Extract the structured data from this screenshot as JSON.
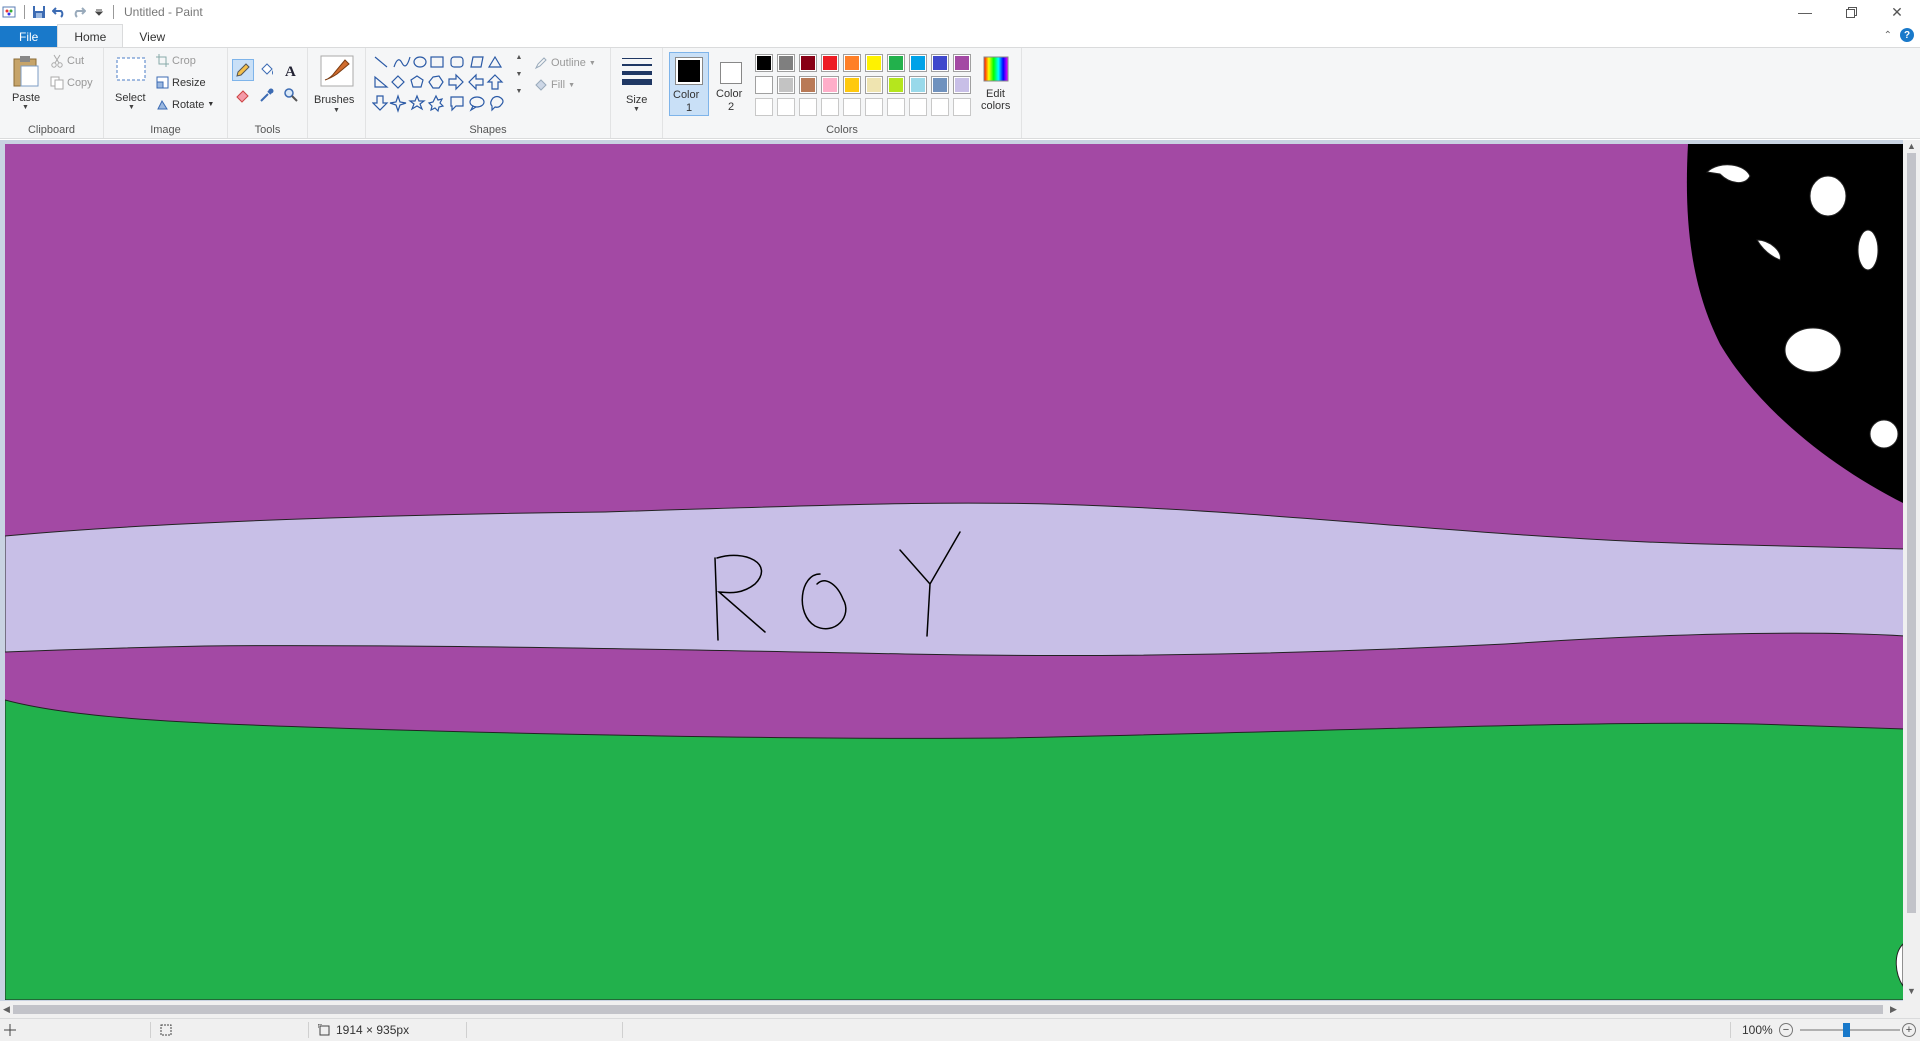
{
  "window": {
    "title": "Untitled - Paint"
  },
  "tabs": [
    {
      "label": "File"
    },
    {
      "label": "Home"
    },
    {
      "label": "View"
    }
  ],
  "ribbon": {
    "clipboard": {
      "label": "Clipboard",
      "paste": "Paste",
      "cut": "Cut",
      "copy": "Copy"
    },
    "image": {
      "label": "Image",
      "select": "Select",
      "crop": "Crop",
      "resize": "Resize",
      "rotate": "Rotate"
    },
    "tools": {
      "label": "Tools"
    },
    "brushes": {
      "label": "Brushes"
    },
    "shapes": {
      "label": "Shapes",
      "outline": "Outline",
      "fill": "Fill"
    },
    "size": {
      "label": "Size"
    },
    "colors": {
      "label": "Colors",
      "color1": "Color 1",
      "color1_line2": "1",
      "color1_line1": "Color",
      "color2_line1": "Color",
      "color2_line2": "2",
      "edit_colors_line1": "Edit",
      "edit_colors_line2": "colors",
      "color1_value": "#000000",
      "color2_value": "#ffffff",
      "palette_row1": [
        "#000000",
        "#7f7f7f",
        "#880015",
        "#ed1c24",
        "#ff7f27",
        "#fff200",
        "#22b14c",
        "#00a2e8",
        "#3f48cc",
        "#a349a4"
      ],
      "palette_row2": [
        "#ffffff",
        "#c3c3c3",
        "#b97a57",
        "#ffaec9",
        "#ffc90e",
        "#efe4b0",
        "#b5e61d",
        "#99d9ea",
        "#7092be",
        "#c8bfe7"
      ],
      "palette_row3": [
        "#ffffff",
        "#ffffff",
        "#ffffff",
        "#ffffff",
        "#ffffff",
        "#ffffff",
        "#ffffff",
        "#ffffff",
        "#ffffff",
        "#ffffff"
      ]
    }
  },
  "drawing": {
    "sky_color": "#a349a4",
    "band_color": "#c8bfe7",
    "grass_color": "#22b14c",
    "moon_color": "#000000",
    "text": "ROY"
  },
  "status": {
    "image_size": "1914 × 935px",
    "zoom": "100%"
  }
}
